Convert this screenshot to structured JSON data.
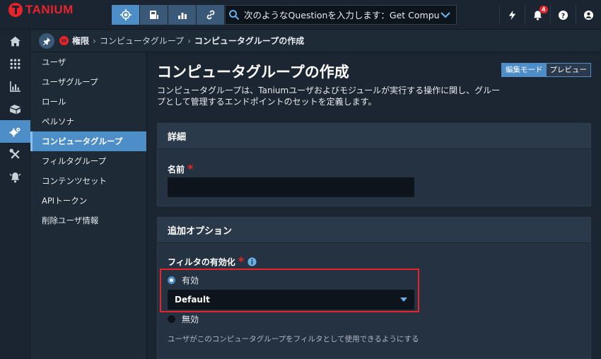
{
  "brand": {
    "name": "TANIUM",
    "color": "#e8232a"
  },
  "topnav": {
    "buttons": [
      {
        "icon": "crosshair-icon",
        "active": true
      },
      {
        "icon": "console-icon",
        "active": false
      },
      {
        "icon": "bar-chart-icon",
        "active": false
      },
      {
        "icon": "link-icon",
        "active": false
      }
    ],
    "search_placeholder": "次のようなQuestionを入力します：Get Computer",
    "notification_count": "4"
  },
  "rail": [
    "home-icon",
    "grid-icon",
    "chart-icon",
    "boxes-icon",
    "gears-icon",
    "tools-icon",
    "alert-bell-icon"
  ],
  "breadcrumb": {
    "root": "権限",
    "parent": "コンピュータグループ",
    "current": "コンピュータグループの作成"
  },
  "sidenav": {
    "items": [
      {
        "label": "ユーザ"
      },
      {
        "label": "ユーザグループ"
      },
      {
        "label": "ロール"
      },
      {
        "label": "ペルソナ"
      },
      {
        "label": "コンピュータグループ"
      },
      {
        "label": "フィルタグループ"
      },
      {
        "label": "コンテンツセット"
      },
      {
        "label": "APIトークン"
      },
      {
        "label": "削除ユーザ情報"
      }
    ],
    "active_index": 4
  },
  "page": {
    "title": "コンピュータグループの作成",
    "description": "コンピュータグループは、Taniumユーザおよびモジュールが実行する操作に関し、グループとして管理するエンドポイントのセットを定義します。",
    "mode_edit": "編集モード",
    "mode_preview": "プレビュー"
  },
  "details": {
    "heading": "詳細",
    "name_label": "名前",
    "required": "*",
    "name_value": ""
  },
  "options": {
    "heading": "追加オプション",
    "filter_label": "フィルタの有効化",
    "enabled_label": "有効",
    "filter_value": "Default",
    "disabled_label": "無効",
    "helper": "ユーザがこのコンピュータグループをフィルタとして使用できるようにする"
  },
  "colors": {
    "accent": "#4d8ec8",
    "background": "#1c2633",
    "highlight": "#e8232a"
  }
}
